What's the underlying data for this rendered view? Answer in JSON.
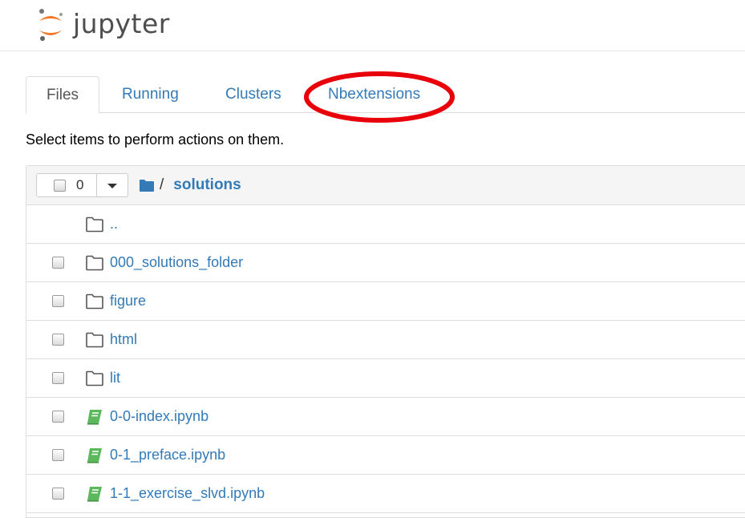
{
  "app": {
    "logo_text": "jupyter"
  },
  "tabs": [
    {
      "label": "Files",
      "active": true
    },
    {
      "label": "Running",
      "active": false
    },
    {
      "label": "Clusters",
      "active": false
    },
    {
      "label": "Nbextensions",
      "active": false,
      "highlighted": true
    }
  ],
  "instructions": "Select items to perform actions on them.",
  "toolbar": {
    "selected_count": "0",
    "breadcrumb_separator": "/",
    "current_folder": "solutions",
    "folder_icon": "folder-solid-icon"
  },
  "files": [
    {
      "name": "..",
      "type": "parent",
      "icon": "folder-outline-icon"
    },
    {
      "name": "000_solutions_folder",
      "type": "folder",
      "icon": "folder-outline-icon"
    },
    {
      "name": "figure",
      "type": "folder",
      "icon": "folder-outline-icon"
    },
    {
      "name": "html",
      "type": "folder",
      "icon": "folder-outline-icon"
    },
    {
      "name": "lit",
      "type": "folder",
      "icon": "folder-outline-icon"
    },
    {
      "name": "0-0-index.ipynb",
      "type": "notebook",
      "icon": "notebook-icon"
    },
    {
      "name": "0-1_preface.ipynb",
      "type": "notebook",
      "icon": "notebook-icon"
    },
    {
      "name": "1-1_exercise_slvd.ipynb",
      "type": "notebook",
      "icon": "notebook-icon"
    }
  ],
  "colors": {
    "link": "#337ab7",
    "notebook_icon": "#5cb85c",
    "annotation": "#e8000b",
    "logo_orange": "#f37726"
  }
}
